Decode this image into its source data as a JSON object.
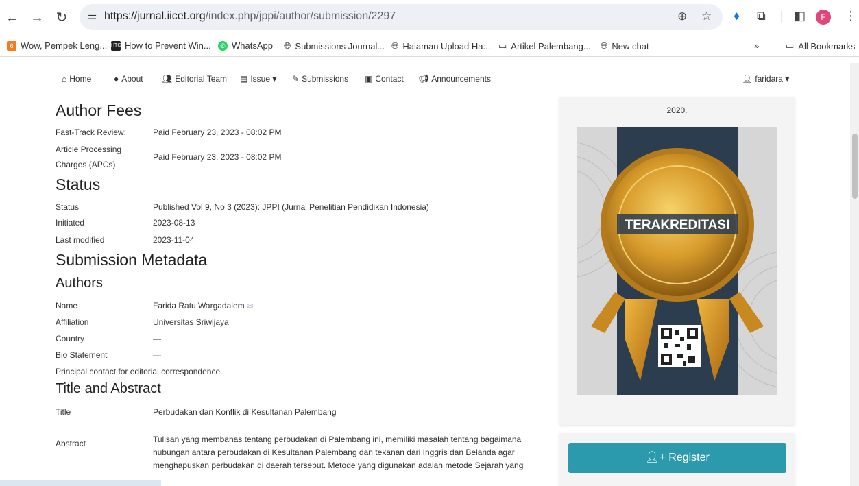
{
  "browser": {
    "url_domain": "https://jurnal.iicet.org",
    "url_path": "/index.php/jppi/author/submission/2297",
    "avatar_letter": "F",
    "bookmarks": [
      {
        "label": "Wow, Pempek Leng...",
        "icon": "orange-app-icon",
        "color": "#f47b20"
      },
      {
        "label": "How to Prevent Win...",
        "icon": "htg-icon",
        "color": "#222222"
      },
      {
        "label": "WhatsApp",
        "icon": "whatsapp-icon",
        "color": "#25d366"
      },
      {
        "label": "Submissions Journal...",
        "icon": "globe-icon",
        "color": "#555555"
      },
      {
        "label": "Halaman Upload Ha...",
        "icon": "globe-icon",
        "color": "#555555"
      },
      {
        "label": "Artikel Palembang...",
        "icon": "folder-icon",
        "color": "#555555"
      },
      {
        "label": "New chat",
        "icon": "globe-icon",
        "color": "#555555"
      }
    ],
    "all_bookmarks": "All Bookmarks",
    "more_bookmarks": "»"
  },
  "nav": {
    "home": "Home",
    "about": "About",
    "editorial": "Editorial Team",
    "issue": "Issue",
    "submissions": "Submissions",
    "contact": "Contact",
    "announcements": "Announcements",
    "user": "faridara"
  },
  "fees": {
    "heading": "Author Fees",
    "fast_label": "Fast-Track Review:",
    "fast_value": "Paid February 23, 2023 - 08:02 PM",
    "apc_label_1": "Article Processing",
    "apc_label_2": "Charges (APCs)",
    "apc_value": "Paid February 23, 2023 - 08:02 PM"
  },
  "status": {
    "heading": "Status",
    "status_label": "Status",
    "status_value": "Published   Vol 9, No 3 (2023): JPPI (Jurnal Penelitian Pendidikan Indonesia)",
    "initiated_label": "Initiated",
    "initiated_value": "2023-08-13",
    "modified_label": "Last modified",
    "modified_value": "2023-11-04"
  },
  "metadata": {
    "heading": "Submission Metadata",
    "authors_heading": "Authors",
    "name_label": "Name",
    "name_value": "Farida Ratu Wargadalem",
    "affiliation_label": "Affiliation",
    "affiliation_value": "Universitas Sriwijaya",
    "country_label": "Country",
    "country_value": "—",
    "bio_label": "Bio Statement",
    "bio_value": "—",
    "principal": "Principal contact for editorial correspondence."
  },
  "title_abstract": {
    "heading": "Title and Abstract",
    "title_label": "Title",
    "title_value": "Perbudakan dan Konflik di Kesultanan Palembang",
    "abstract_label": "Abstract",
    "abstract_value": "Tulisan yang membahas tentang perbudakan di Palembang ini, memiliki masalah tentang bagaimana hubungan antara perbudakan di Kesultanan Palembang dan tekanan dari Inggris dan Belanda agar menghapuskan perbudakan di daerah tersebut. Metode yang digunakan adalah metode Sejarah yang"
  },
  "sidebar": {
    "date_line": "2020.",
    "badge_text": "TERAKREDITASI",
    "register": "Register"
  }
}
